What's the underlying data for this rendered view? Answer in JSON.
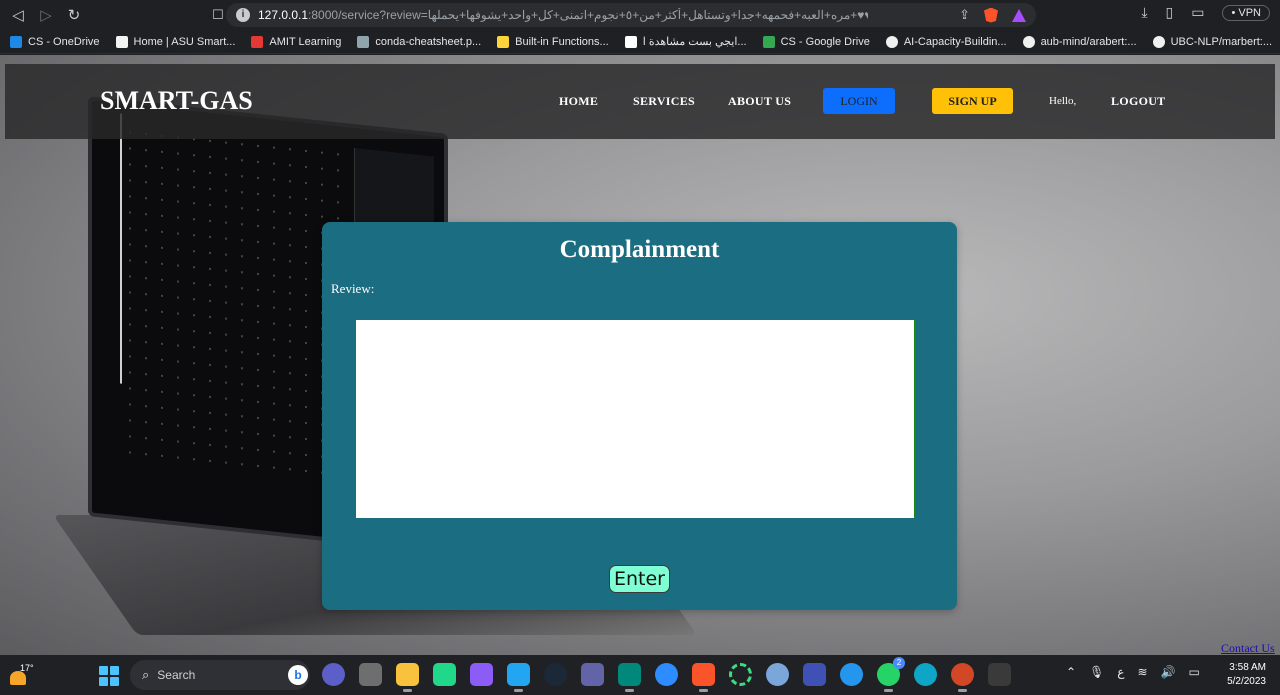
{
  "browser": {
    "address": {
      "host": "127.0.0.1",
      "path": ":8000/service?review=مره+العبه+فحمهه+جدا+وتستاهل+أكثر+من+٥+نجوم+اتمنى+كل+واحد+يشوفها+يحملها+♥♥+✨+✨+✨♥♥❤..."
    },
    "vpn_label": "• VPN",
    "bookmarks": [
      {
        "label": "CS - OneDrive",
        "color": "#1e88e5"
      },
      {
        "label": "Home | ASU Smart...",
        "color": "#f2f2f2"
      },
      {
        "label": "AMIT Learning",
        "color": "#e53935"
      },
      {
        "label": "conda-cheatsheet.p...",
        "color": "#90a4ae"
      },
      {
        "label": "Built-in Functions...",
        "color": "#ffd43b"
      },
      {
        "label": "ايجي بست مشاهدة ا...",
        "color": "#ffffff"
      },
      {
        "label": "CS - Google Drive",
        "color": "#34a853"
      },
      {
        "label": "AI-Capacity-Buildin...",
        "color": "#f0f0f0"
      },
      {
        "label": "aub-mind/arabert:...",
        "color": "#f0f0f0"
      },
      {
        "label": "UBC-NLP/marbert:...",
        "color": "#f0f0f0"
      }
    ],
    "more_label": "»"
  },
  "site": {
    "logo": "SMART-GAS",
    "nav": {
      "home": "HOME",
      "services": "SERVICES",
      "about": "ABOUT US",
      "login": "LOGIN",
      "signup": "SIGN UP",
      "hello": "Hello,",
      "logout": "LOGOUT"
    },
    "colors": {
      "login": "#0d6efd",
      "signup": "#ffc107",
      "card": "#1b6d81",
      "enter": "#7fffd4"
    }
  },
  "form": {
    "title": "Complainment",
    "review_label": "Review:",
    "review_value": "",
    "submit_label": "Enter"
  },
  "footer": {
    "contact": "Contact Us"
  },
  "taskbar": {
    "temperature": "17°",
    "search_label": "Search",
    "time": "3:58 AM",
    "date": "5/2/2023",
    "whatsapp_badge": "2",
    "tray_lang": "ع",
    "apps": [
      {
        "name": "teams-chat",
        "color": "#5b5fc7"
      },
      {
        "name": "settings",
        "color": "#6e6e6e"
      },
      {
        "name": "file-explorer",
        "color": "#f9c23c"
      },
      {
        "name": "pycharm",
        "color": "#21d789"
      },
      {
        "name": "visual-studio",
        "color": "#8b5cf6"
      },
      {
        "name": "vscode",
        "color": "#22a6f2"
      },
      {
        "name": "steam",
        "color": "#1b2838"
      },
      {
        "name": "teams",
        "color": "#6264a7"
      },
      {
        "name": "meet",
        "color": "#00897b"
      },
      {
        "name": "zoom",
        "color": "#2d8cff"
      },
      {
        "name": "brave",
        "color": "#fb542b"
      },
      {
        "name": "progress",
        "color": "#3ddc84"
      },
      {
        "name": "r",
        "color": "#7aa6da"
      },
      {
        "name": "mathcad",
        "color": "#3f51b5"
      },
      {
        "name": "docker",
        "color": "#2496ed"
      },
      {
        "name": "whatsapp",
        "color": "#25d366"
      },
      {
        "name": "edge",
        "color": "#0fa5c7"
      },
      {
        "name": "powerpoint",
        "color": "#d24726"
      },
      {
        "name": "terminal",
        "color": "#3a3a3a"
      }
    ]
  }
}
